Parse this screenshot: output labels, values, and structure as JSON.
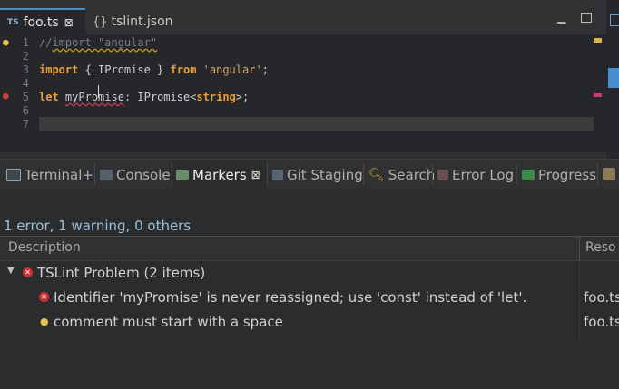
{
  "editor": {
    "tabs": [
      {
        "label": "foo.ts",
        "icon": "typescript-icon",
        "icon_text": "TS",
        "active": true
      },
      {
        "label": "tslint.json",
        "icon": "json-icon",
        "icon_text": "{}",
        "active": false
      }
    ],
    "lines": [
      {
        "no": "1",
        "c1": "//",
        "c2": "import \"angular\""
      },
      {
        "no": "2"
      },
      {
        "no": "3",
        "kw1": "import",
        "t1": " { IPromise } ",
        "kw2": "from",
        "t2": " ",
        "s1": "'angular'",
        "t3": ";"
      },
      {
        "no": "4"
      },
      {
        "no": "5",
        "kw1": "let",
        "t1": " ",
        "v1": "myPromise",
        "t2": ": IPromise<",
        "kw2": "string",
        "t3": ">;"
      },
      {
        "no": "6"
      },
      {
        "no": "7"
      }
    ]
  },
  "views": {
    "tabs": [
      {
        "label": "Terminal+",
        "icon": "terminal-icon"
      },
      {
        "label": "Console",
        "icon": "console-icon"
      },
      {
        "label": "Markers",
        "icon": "markers-icon",
        "active": true
      },
      {
        "label": "Git Staging",
        "icon": "git-icon"
      },
      {
        "label": "Search",
        "icon": "search-icon"
      },
      {
        "label": "Error Log",
        "icon": "error-log-icon"
      },
      {
        "label": "Progress",
        "icon": "progress-icon"
      }
    ]
  },
  "markers": {
    "summary": "1 error, 1 warning, 0 others",
    "columns": {
      "description": "Description",
      "resource": "Reso"
    },
    "group": {
      "label": "TSLint Problem (2 items)"
    },
    "items": [
      {
        "type": "error",
        "description": "Identifier 'myPromise' is never reassigned; use 'const' instead of 'let'.",
        "resource": "foo.ts"
      },
      {
        "type": "warning",
        "description": "comment must start with a space",
        "resource": "foo.ts"
      }
    ]
  },
  "colors": {
    "accent": "#4a90c8",
    "keyword": "#e59e3a",
    "error": "#c83232",
    "warning": "#e8c24a"
  }
}
